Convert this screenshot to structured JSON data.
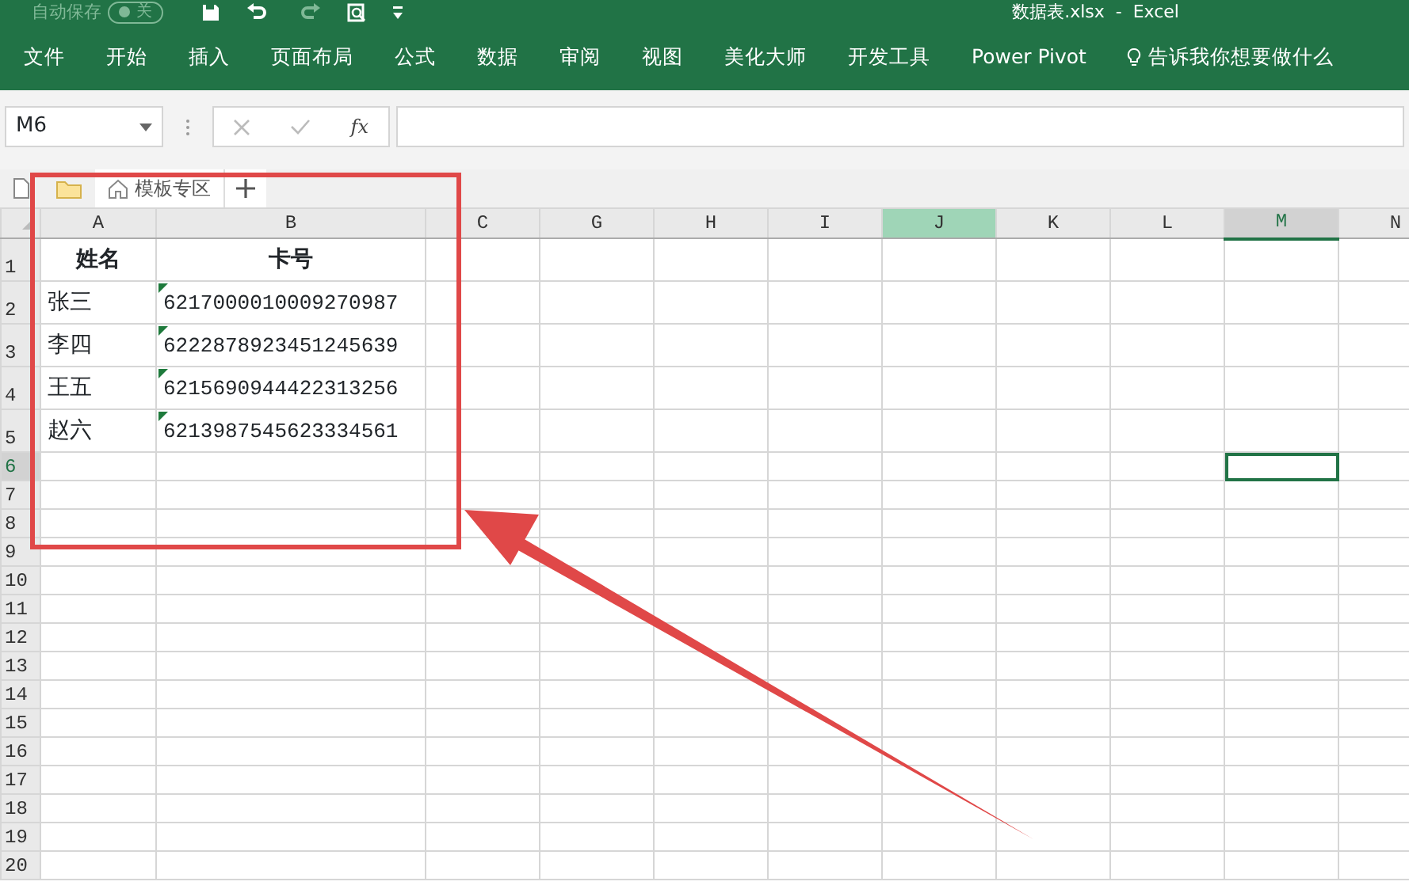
{
  "quick_access": {
    "autosave_label": "自动保存",
    "autosave_state": "关",
    "autosave_on": false
  },
  "window": {
    "title": "数据表.xlsx  -  Excel"
  },
  "ribbon_tabs": [
    "文件",
    "开始",
    "插入",
    "页面布局",
    "公式",
    "数据",
    "审阅",
    "视图",
    "美化大师",
    "开发工具",
    "Power Pivot"
  ],
  "tell_me": "告诉我你想要做什么",
  "formula_bar": {
    "name_box": "M6",
    "function_label": "fx"
  },
  "sheet_tabs": [
    {
      "label": "模板专区"
    }
  ],
  "columns": [
    {
      "label": "A",
      "selected": false,
      "highlighted": false
    },
    {
      "label": "B",
      "selected": false,
      "highlighted": false
    },
    {
      "label": "C",
      "selected": false,
      "highlighted": false
    },
    {
      "label": "G",
      "selected": false,
      "highlighted": false
    },
    {
      "label": "H",
      "selected": false,
      "highlighted": false
    },
    {
      "label": "I",
      "selected": false,
      "highlighted": false
    },
    {
      "label": "J",
      "selected": false,
      "highlighted": true
    },
    {
      "label": "K",
      "selected": false,
      "highlighted": false
    },
    {
      "label": "L",
      "selected": false,
      "highlighted": false
    },
    {
      "label": "M",
      "selected": true,
      "highlighted": false
    },
    {
      "label": "N",
      "selected": false,
      "highlighted": false
    }
  ],
  "rows": [
    {
      "label": "1",
      "selected": false,
      "cells": [
        {
          "text": "姓名",
          "bold": true,
          "flag": false
        },
        {
          "text": "卡号",
          "bold": true,
          "flag": false
        }
      ]
    },
    {
      "label": "2",
      "selected": false,
      "cells": [
        {
          "text": "张三",
          "bold": false,
          "flag": false
        },
        {
          "text": "6217000010009270987",
          "bold": false,
          "flag": true
        }
      ]
    },
    {
      "label": "3",
      "selected": false,
      "cells": [
        {
          "text": "李四",
          "bold": false,
          "flag": false
        },
        {
          "text": "6222878923451245639",
          "bold": false,
          "flag": true
        }
      ]
    },
    {
      "label": "4",
      "selected": false,
      "cells": [
        {
          "text": "王五",
          "bold": false,
          "flag": false
        },
        {
          "text": "6215690944422313256",
          "bold": false,
          "flag": true
        }
      ]
    },
    {
      "label": "5",
      "selected": false,
      "cells": [
        {
          "text": "赵六",
          "bold": false,
          "flag": false
        },
        {
          "text": "6213987545623334561",
          "bold": false,
          "flag": true
        }
      ]
    },
    {
      "label": "6",
      "selected": true
    },
    {
      "label": "7",
      "selected": false
    },
    {
      "label": "8",
      "selected": false
    },
    {
      "label": "9",
      "selected": false
    },
    {
      "label": "10",
      "selected": false
    },
    {
      "label": "11",
      "selected": false
    },
    {
      "label": "12",
      "selected": false
    },
    {
      "label": "13",
      "selected": false
    },
    {
      "label": "14",
      "selected": false
    },
    {
      "label": "15",
      "selected": false
    },
    {
      "label": "16",
      "selected": false
    },
    {
      "label": "17",
      "selected": false
    },
    {
      "label": "18",
      "selected": false
    },
    {
      "label": "19",
      "selected": false
    },
    {
      "label": "20",
      "selected": false
    }
  ]
}
